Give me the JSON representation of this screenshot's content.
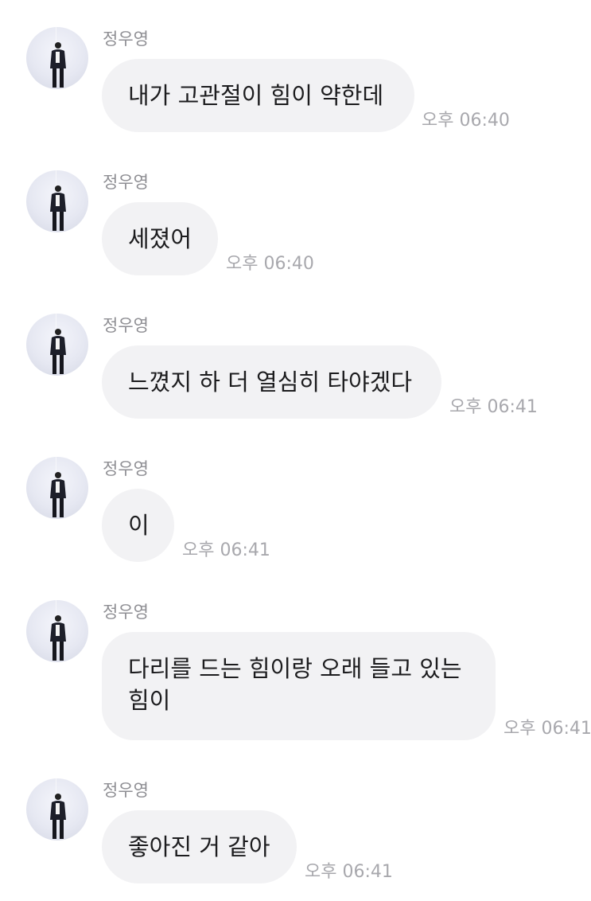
{
  "messages": [
    {
      "sender": "정우영",
      "text": "내가 고관절이 힘이 약한데",
      "time": "오후 06:40"
    },
    {
      "sender": "정우영",
      "text": "세졌어",
      "time": "오후 06:40"
    },
    {
      "sender": "정우영",
      "text": "느꼈지 하 더 열심히 타야겠다",
      "time": "오후 06:41"
    },
    {
      "sender": "정우영",
      "text": "이",
      "time": "오후 06:41"
    },
    {
      "sender": "정우영",
      "text_line1": "다리를 드는 힘이랑 오래 들고 있는",
      "text_line2": "힘이",
      "time": "오후 06:41"
    },
    {
      "sender": "정우영",
      "text": "좋아진 거 같아",
      "time": "오후 06:41"
    }
  ],
  "icons": {
    "avatar": "profile-photo-person-standing"
  }
}
